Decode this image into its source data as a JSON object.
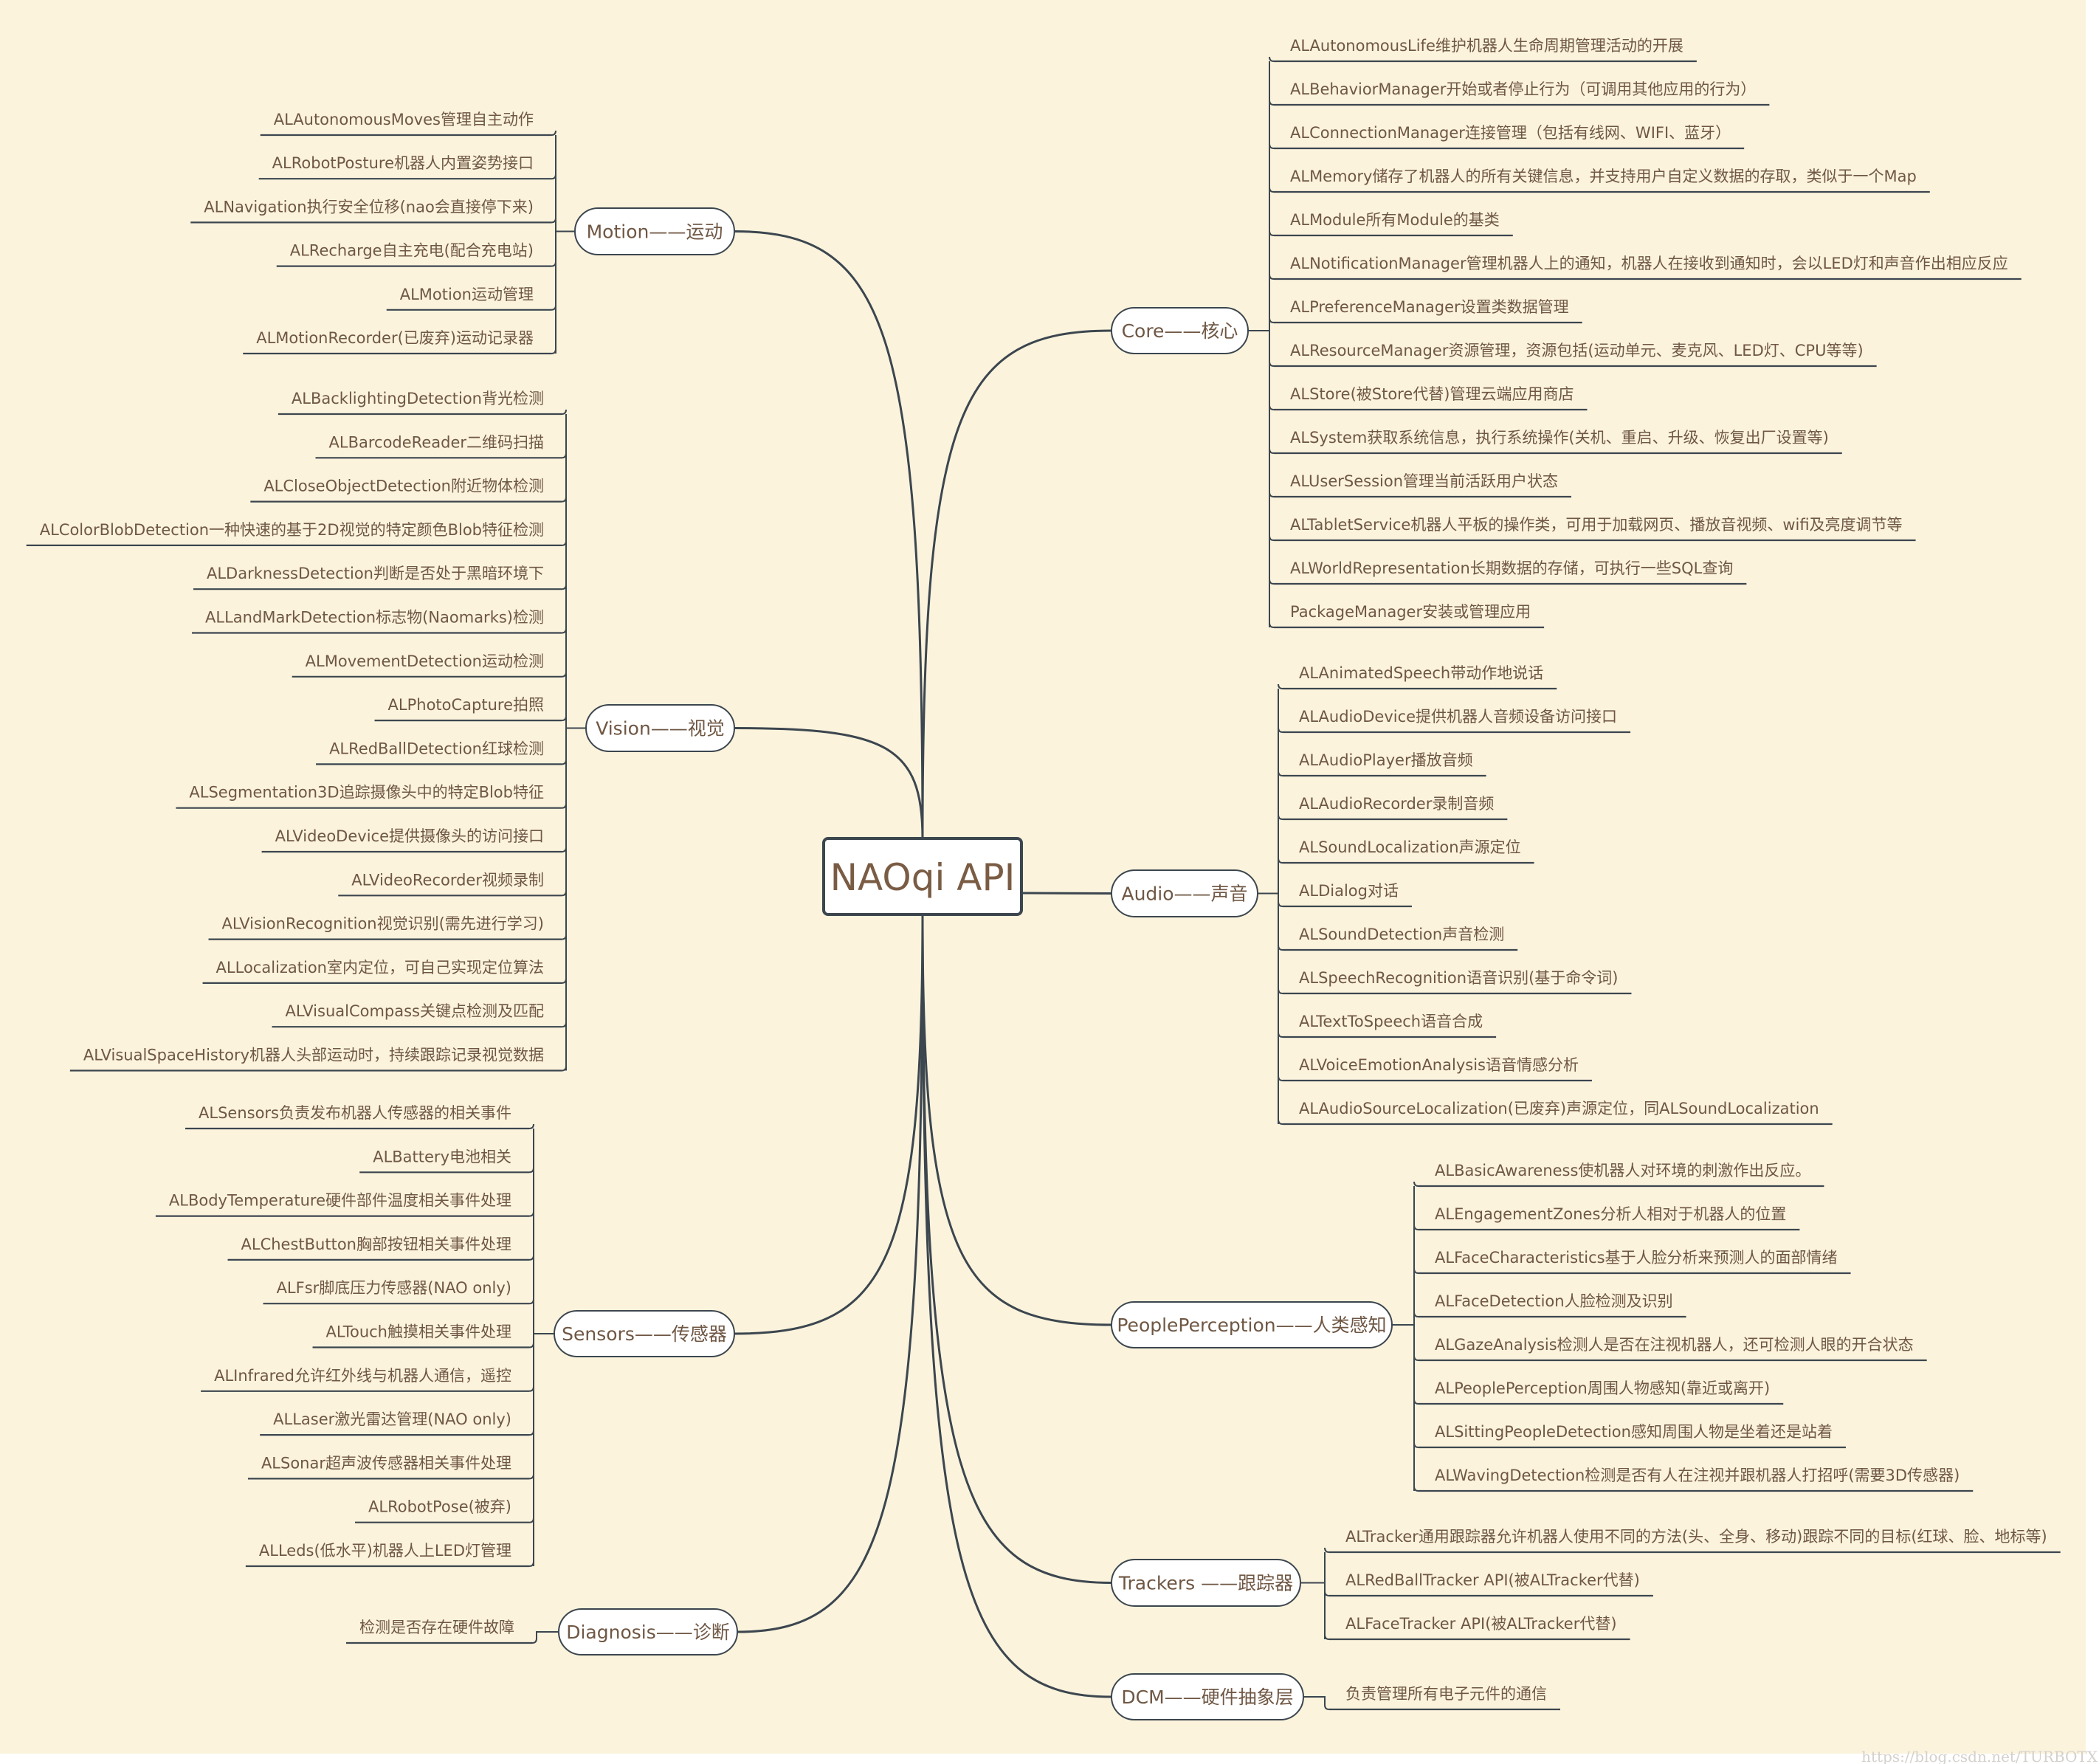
{
  "title": "NAOqi API",
  "colors": {
    "background": "#fbf3dc",
    "line": "#3c464f",
    "text": "#6f5744",
    "node_fill": "#ffffff"
  },
  "watermark": "https://blog.csdn.net/TURBOTX",
  "branches": [
    {
      "id": "motion",
      "side": "left",
      "label": "Motion——运动",
      "items": [
        "ALAutonomousMoves管理自主动作",
        "ALRobotPosture机器人内置姿势接口",
        "ALNavigation执行安全位移(nao会直接停下来)",
        "ALRecharge自主充电(配合充电站)",
        "ALMotion运动管理",
        "ALMotionRecorder(已废弃)运动记录器"
      ]
    },
    {
      "id": "vision",
      "side": "left",
      "label": "Vision——视觉",
      "items": [
        "ALBacklightingDetection背光检测",
        "ALBarcodeReader二维码扫描",
        "ALCloseObjectDetection附近物体检测",
        "ALColorBlobDetection一种快速的基于2D视觉的特定颜色Blob特征检测",
        "ALDarknessDetection判断是否处于黑暗环境下",
        "ALLandMarkDetection标志物(Naomarks)检测",
        "ALMovementDetection运动检测",
        "ALPhotoCapture拍照",
        "ALRedBallDetection红球检测",
        "ALSegmentation3D追踪摄像头中的特定Blob特征",
        "ALVideoDevice提供摄像头的访问接口",
        "ALVideoRecorder视频录制",
        "ALVisionRecognition视觉识别(需先进行学习)",
        "ALLocalization室内定位，可自己实现定位算法",
        "ALVisualCompass关键点检测及匹配",
        "ALVisualSpaceHistory机器人头部运动时，持续跟踪记录视觉数据"
      ]
    },
    {
      "id": "sensors",
      "side": "left",
      "label": "Sensors——传感器",
      "items": [
        "ALSensors负责发布机器人传感器的相关事件",
        "ALBattery电池相关",
        "ALBodyTemperature硬件部件温度相关事件处理",
        "ALChestButton胸部按钮相关事件处理",
        "ALFsr脚底压力传感器(NAO only)",
        "ALTouch触摸相关事件处理",
        "ALInfrared允许红外线与机器人通信，遥控",
        "ALLaser激光雷达管理(NAO only)",
        "ALSonar超声波传感器相关事件处理",
        "ALRobotPose(被弃)",
        "ALLeds(低水平)机器人上LED灯管理"
      ]
    },
    {
      "id": "diagnosis",
      "side": "left",
      "label": "Diagnosis——诊断",
      "items": [
        "检测是否存在硬件故障"
      ]
    },
    {
      "id": "core",
      "side": "right",
      "label": "Core——核心",
      "items": [
        "ALAutonomousLife维护机器人生命周期管理活动的开展",
        "ALBehaviorManager开始或者停止行为（可调用其他应用的行为）",
        "ALConnectionManager连接管理（包括有线网、WIFI、蓝牙）",
        "ALMemory储存了机器人的所有关键信息，并支持用户自定义数据的存取，类似于一个Map",
        "ALModule所有Module的基类",
        "ALNotificationManager管理机器人上的通知，机器人在接收到通知时，会以LED灯和声音作出相应反应",
        "ALPreferenceManager设置类数据管理",
        "ALResourceManager资源管理，资源包括(运动单元、麦克风、LED灯、CPU等等)",
        "ALStore(被Store代替)管理云端应用商店",
        "ALSystem获取系统信息，执行系统操作(关机、重启、升级、恢复出厂设置等)",
        "ALUserSession管理当前活跃用户状态",
        "ALTabletService机器人平板的操作类，可用于加载网页、播放音视频、wifi及亮度调节等",
        "ALWorldRepresentation长期数据的存储，可执行一些SQL查询",
        "PackageManager安装或管理应用"
      ]
    },
    {
      "id": "audio",
      "side": "right",
      "label": "Audio——声音",
      "items": [
        "ALAnimatedSpeech带动作地说话",
        "ALAudioDevice提供机器人音频设备访问接口",
        "ALAudioPlayer播放音频",
        "ALAudioRecorder录制音频",
        "ALSoundLocalization声源定位",
        "ALDialog对话",
        "ALSoundDetection声音检测",
        "ALSpeechRecognition语音识别(基于命令词)",
        "ALTextToSpeech语音合成",
        "ALVoiceEmotionAnalysis语音情感分析",
        "ALAudioSourceLocalization(已废弃)声源定位，同ALSoundLocalization"
      ]
    },
    {
      "id": "peopleperception",
      "side": "right",
      "label": "PeoplePerception——人类感知",
      "items": [
        "ALBasicAwareness使机器人对环境的刺激作出反应。",
        "ALEngagementZones分析人相对于机器人的位置",
        "ALFaceCharacteristics基于人脸分析来预测人的面部情绪",
        "ALFaceDetection人脸检测及识别",
        "ALGazeAnalysis检测人是否在注视机器人，还可检测人眼的开合状态",
        "ALPeoplePerception周围人物感知(靠近或离开)",
        "ALSittingPeopleDetection感知周围人物是坐着还是站着",
        "ALWavingDetection检测是否有人在注视并跟机器人打招呼(需要3D传感器)"
      ]
    },
    {
      "id": "trackers",
      "side": "right",
      "label": "Trackers ——跟踪器",
      "items": [
        "ALTracker通用跟踪器允许机器人使用不同的方法(头、全身、移动)跟踪不同的目标(红球、脸、地标等)",
        "ALRedBallTracker API(被ALTracker代替)",
        "ALFaceTracker API(被ALTracker代替)"
      ]
    },
    {
      "id": "dcm",
      "side": "right",
      "label": "DCM——硬件抽象层",
      "items": [
        "负责管理所有电子元件的通信"
      ]
    }
  ]
}
